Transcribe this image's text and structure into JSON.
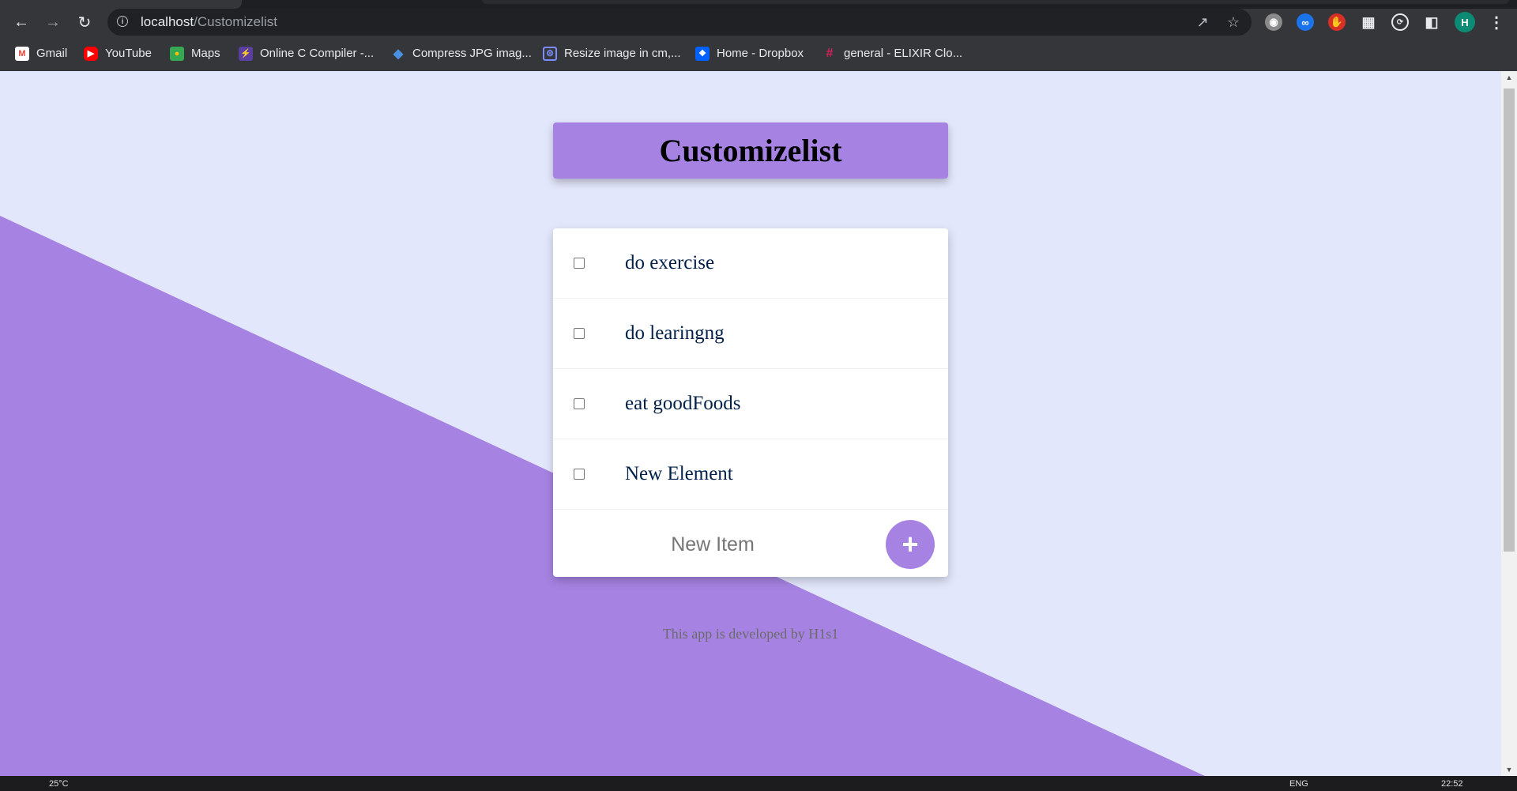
{
  "browser": {
    "url_host": "localhost",
    "url_path": "/Customizelist",
    "profile_initial": "H"
  },
  "bookmarks": [
    {
      "label": "Gmail",
      "icon": "gmail-icon"
    },
    {
      "label": "YouTube",
      "icon": "youtube-icon"
    },
    {
      "label": "Maps",
      "icon": "maps-icon"
    },
    {
      "label": "Online C Compiler -...",
      "icon": "compiler-icon"
    },
    {
      "label": "Compress JPG imag...",
      "icon": "compress-icon"
    },
    {
      "label": "Resize image in cm,...",
      "icon": "resize-icon"
    },
    {
      "label": "Home - Dropbox",
      "icon": "dropbox-icon"
    },
    {
      "label": "general - ELIXIR Clo...",
      "icon": "slack-icon"
    }
  ],
  "app": {
    "title": "Customizelist",
    "items": [
      {
        "label": "do exercise",
        "checked": false
      },
      {
        "label": "do learingng",
        "checked": false
      },
      {
        "label": "eat goodFoods",
        "checked": false
      },
      {
        "label": "New Element",
        "checked": false
      }
    ],
    "new_item_placeholder": "New Item",
    "add_button_label": "+",
    "footer": "This app is developed by H1s1"
  },
  "colors": {
    "accent": "#a683e3",
    "background": "#e3e7fb",
    "item_text": "#00204a"
  },
  "taskbar": {
    "temperature": "25°C",
    "language": "ENG",
    "time": "22:52"
  }
}
